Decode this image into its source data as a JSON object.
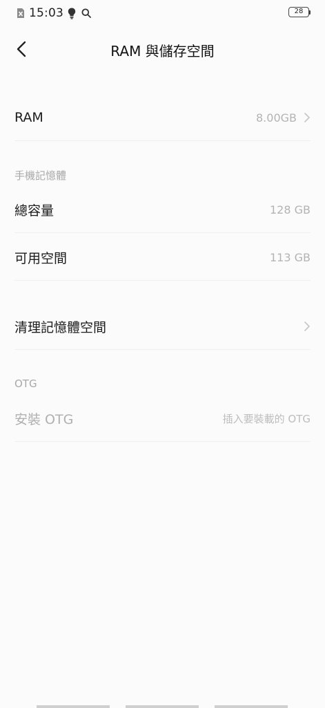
{
  "status_bar": {
    "time": "15:03",
    "battery_level": "28"
  },
  "header": {
    "title": "RAM 與儲存空間"
  },
  "ram": {
    "label": "RAM",
    "value": "8.00GB"
  },
  "phone_storage": {
    "section_title": "手機記憶體",
    "total_label": "總容量",
    "total_value": "128 GB",
    "available_label": "可用空間",
    "available_value": "113 GB"
  },
  "cleanup": {
    "label": "清理記憶體空間"
  },
  "otg": {
    "section_title": "OTG",
    "install_label": "安裝 OTG",
    "install_hint": "插入要裝載的 OTG"
  },
  "colors": {
    "background": "#fbfbfb",
    "primary_text": "#1c1c1c",
    "secondary_text": "#b3b3b3",
    "section_text": "#a8a8a8",
    "divider": "#efefef"
  }
}
